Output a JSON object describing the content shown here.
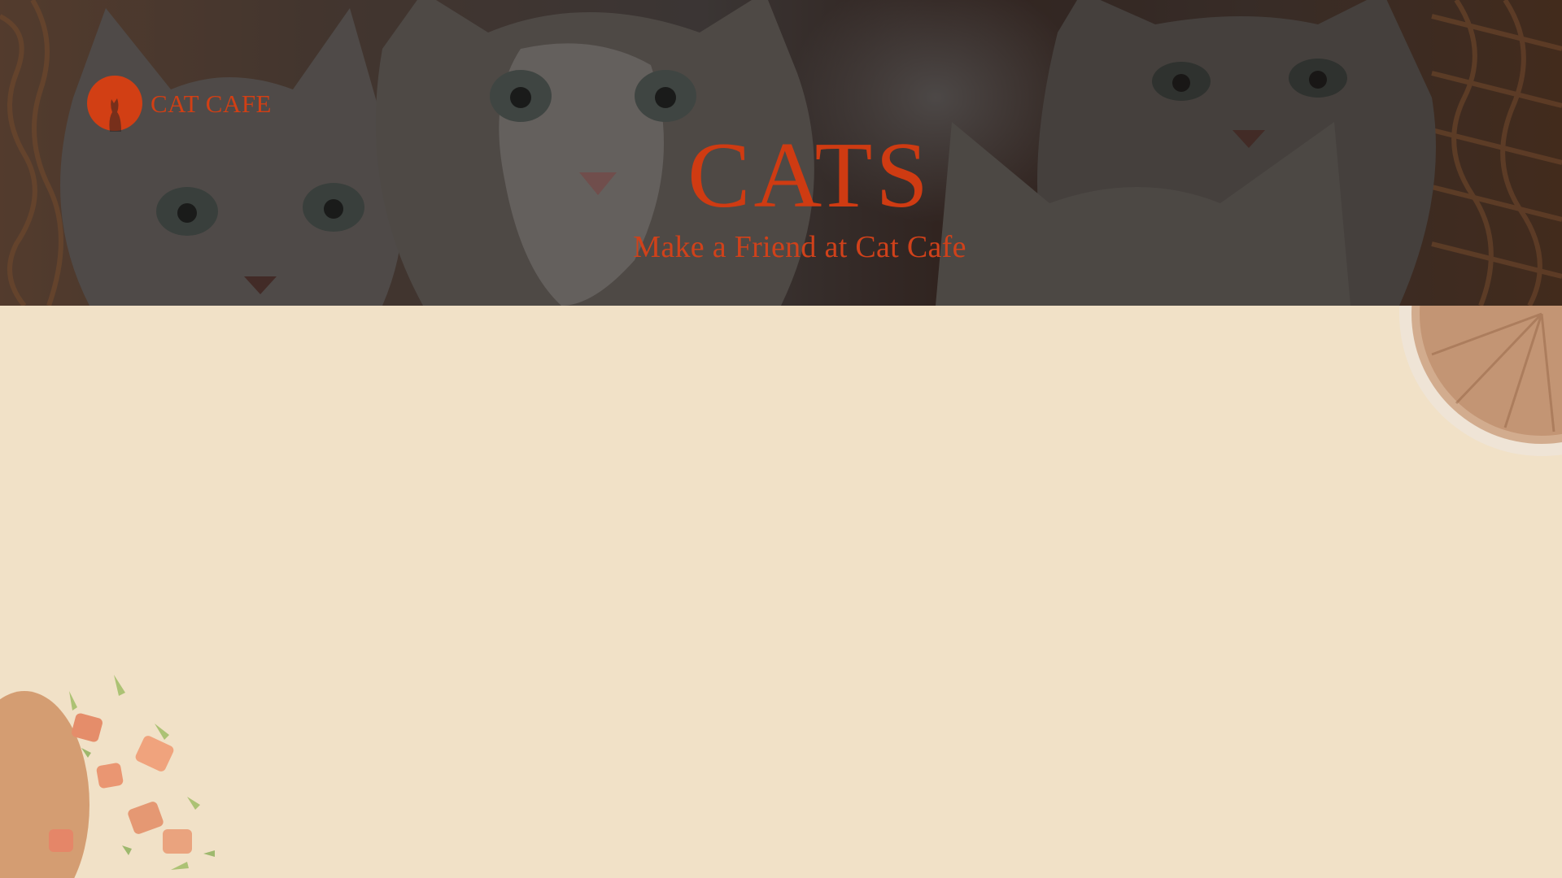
{
  "brand": {
    "name": "CAT CAFE",
    "logo_icon": "cat-silhouette-icon"
  },
  "hero": {
    "title": "CATS",
    "subtitle": "Make a Friend at Cat Cafe"
  },
  "colors": {
    "accent": "#cf3b12",
    "background": "#f1e1c7",
    "hero_overlay": "#2a221e"
  },
  "decorations": {
    "top_right": "coffee-plate-image",
    "bottom_left": "tomato-salad-image"
  }
}
